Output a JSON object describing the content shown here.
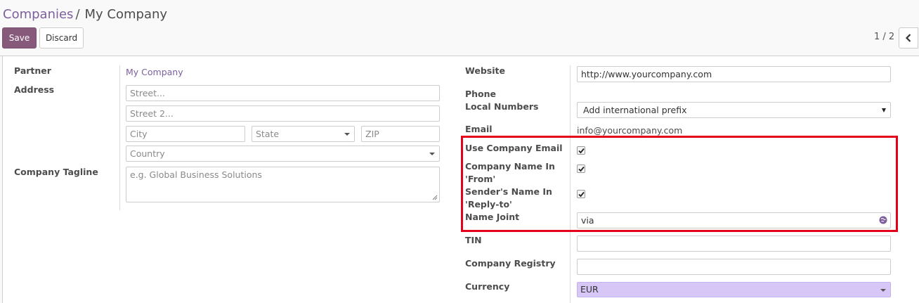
{
  "breadcrumb": {
    "parent": "Companies",
    "separator": "/",
    "current": "My Company"
  },
  "toolbar": {
    "save_label": "Save",
    "discard_label": "Discard"
  },
  "pager": {
    "value": "1 / 2"
  },
  "left": {
    "partner_label": "Partner",
    "partner_value": "My Company",
    "address_label": "Address",
    "street_placeholder": "Street...",
    "street2_placeholder": "Street 2...",
    "city_placeholder": "City",
    "state_placeholder": "State",
    "zip_placeholder": "ZIP",
    "country_placeholder": "Country",
    "tagline_label": "Company Tagline",
    "tagline_placeholder": "e.g. Global Business Solutions"
  },
  "right": {
    "website_label": "Website",
    "website_value": "http://www.yourcompany.com",
    "phone_label": "Phone",
    "local_numbers_label": "Local Numbers",
    "local_numbers_value": "Add international prefix",
    "email_label": "Email",
    "email_value": "info@yourcompany.com",
    "use_company_email_label": "Use Company Email",
    "use_company_email_checked": true,
    "company_name_in_from_label_1": "Company Name In",
    "company_name_in_from_label_2": "'From'",
    "company_name_in_from_checked": true,
    "sender_name_reply_label_1": "Sender's Name In",
    "sender_name_reply_label_2": "'Reply-to'",
    "sender_name_reply_checked": true,
    "name_joint_label": "Name Joint",
    "name_joint_value": "via",
    "tin_label": "TIN",
    "company_registry_label": "Company Registry",
    "currency_label": "Currency",
    "currency_value": "EUR"
  },
  "colors": {
    "brand": "#875a7b",
    "link": "#7c5f9c",
    "highlight": "#e2001a",
    "currency_bg": "#d6c7f6"
  },
  "icons": {
    "pager_prev": "chevron-left-icon",
    "name_joint_translate": "globe-icon",
    "checkbox": "checkmark-icon"
  }
}
